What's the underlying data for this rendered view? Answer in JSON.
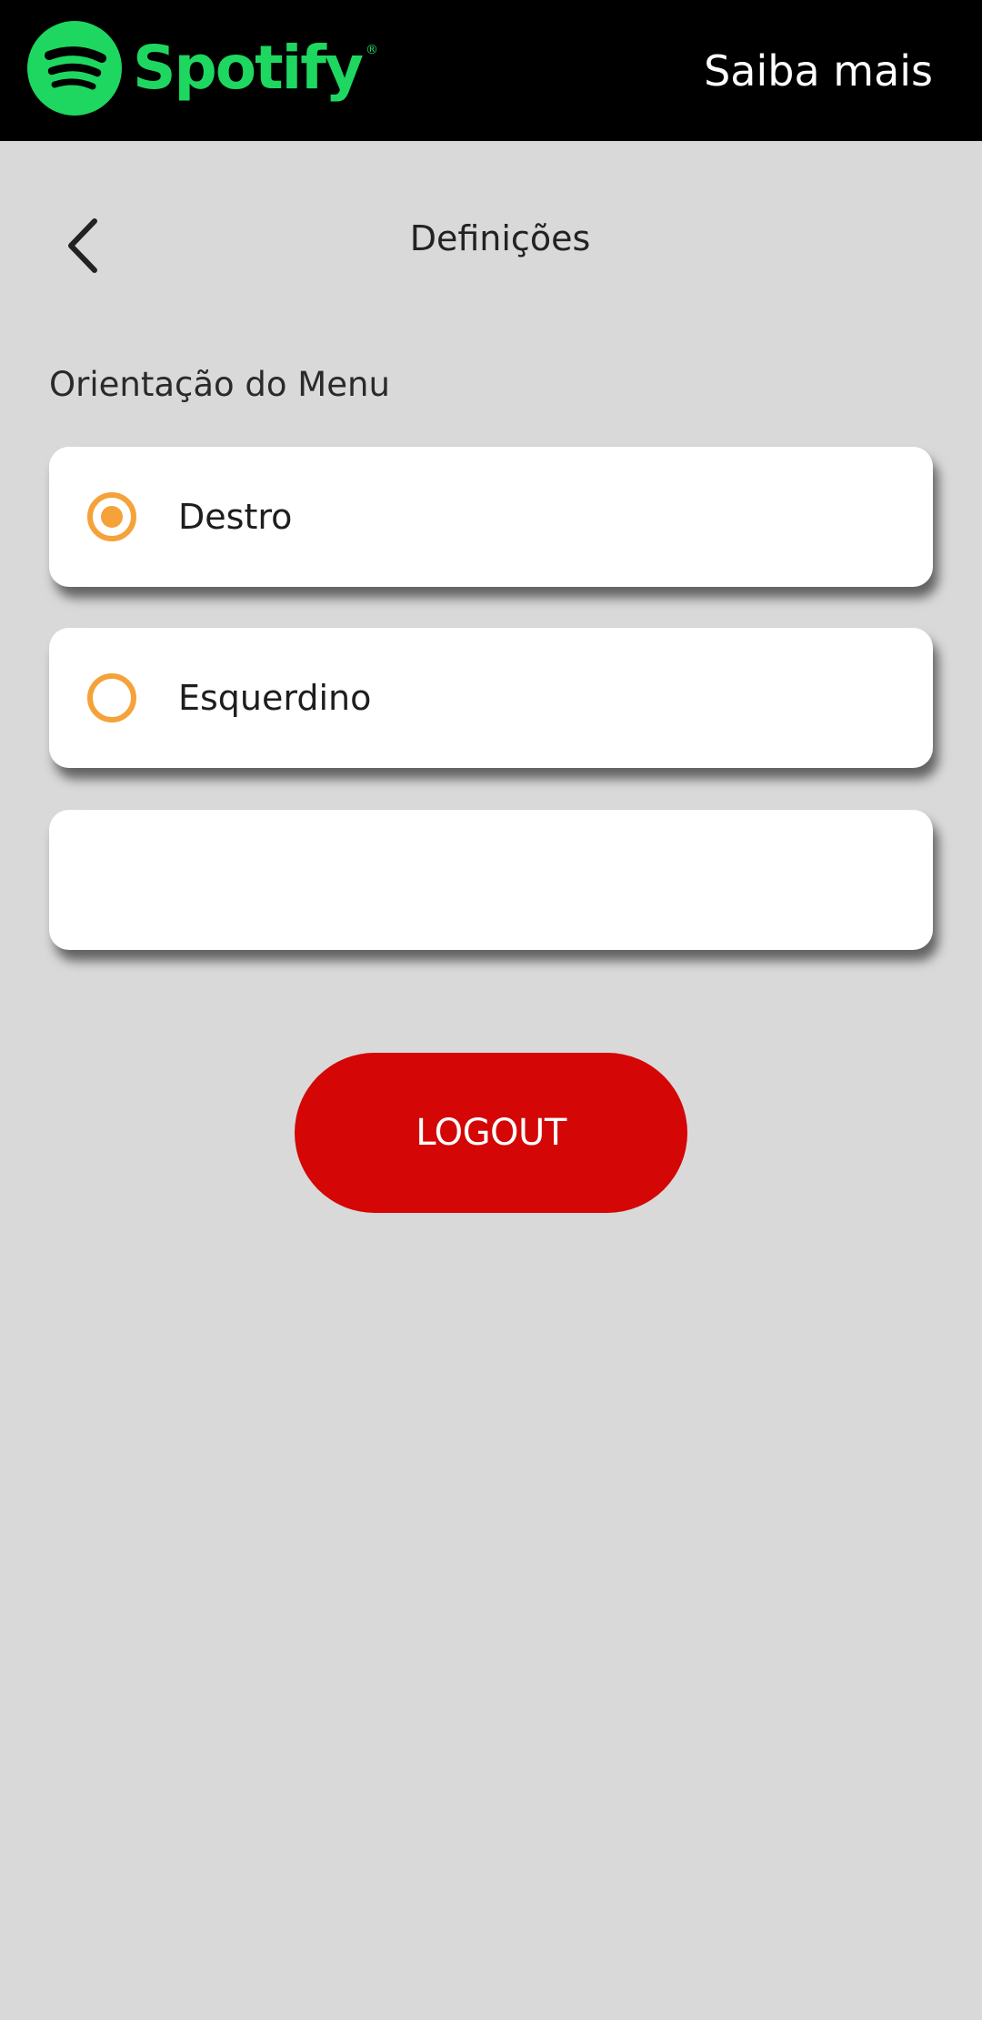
{
  "header": {
    "logo_text": "Spotify",
    "logo_registered": "®",
    "learn_more_label": "Saiba mais"
  },
  "page": {
    "title": "Definições",
    "back_icon": "chevron-left-icon"
  },
  "settings": {
    "menu_orientation_label": "Orientação do Menu",
    "options": [
      {
        "label": "Destro",
        "selected": true
      },
      {
        "label": "Esquerdino",
        "selected": false
      },
      {
        "label": "",
        "selected": false
      }
    ]
  },
  "actions": {
    "logout_label": "LOGOUT"
  },
  "colors": {
    "brand_green": "#1ed760",
    "radio_accent": "#f5a23a",
    "logout_red": "#d40606",
    "background": "#d9d9d9"
  }
}
